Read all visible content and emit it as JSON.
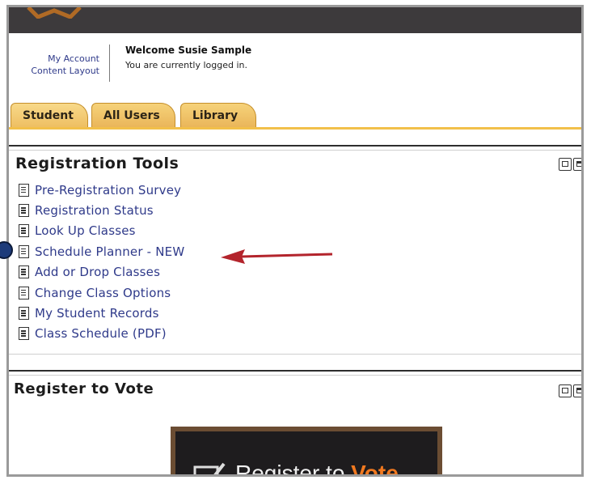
{
  "header": {
    "account_links": [
      "My Account",
      "Content Layout"
    ],
    "welcome": "Welcome Susie Sample",
    "status": "You are currently logged in."
  },
  "tabs": [
    {
      "label": "Student",
      "active": true
    },
    {
      "label": "All Users",
      "active": false
    },
    {
      "label": "Library",
      "active": false
    }
  ],
  "registration_tools": {
    "title": "Registration Tools",
    "links": [
      "Pre-Registration Survey",
      "Registration Status",
      "Look Up Classes",
      "Schedule Planner - NEW",
      "Add or Drop Classes",
      "Change Class Options",
      "My Student Records",
      "Class Schedule (PDF)"
    ],
    "highlighted_link": "Schedule Planner - NEW"
  },
  "register_to_vote": {
    "title": "Register to Vote",
    "banner_text_main": "Register to ",
    "banner_text_highlight": "Vote"
  },
  "colors": {
    "link": "#2f3a8a",
    "tab": "#f0c46a",
    "accent_line": "#f2c04a",
    "arrow": "#b3242c",
    "topbar": "#3d3a3c",
    "vote_highlight": "#f2791f"
  },
  "icons": [
    "document-icon",
    "minimize-icon",
    "edit-icon",
    "arrow-annotation",
    "checkmark-icon"
  ]
}
